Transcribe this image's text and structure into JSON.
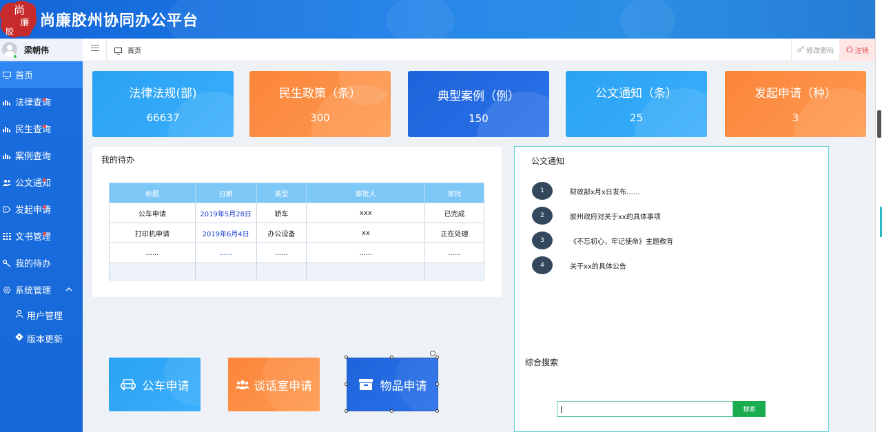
{
  "app": {
    "title": "尚廉胶州协同办公平台",
    "logo_text": "尚廉胶州"
  },
  "user": {
    "name": "梁朝伟"
  },
  "sidebar": {
    "items": [
      {
        "label": "首页",
        "icon": "monitor-icon"
      },
      {
        "label": "法律查询",
        "icon": "bar-chart-icon"
      },
      {
        "label": "民生查询",
        "icon": "bar-chart-icon"
      },
      {
        "label": "案例查询",
        "icon": "bar-chart-icon"
      },
      {
        "label": "公文通知",
        "icon": "users-icon"
      },
      {
        "label": "发起申请",
        "icon": "tag-icon"
      },
      {
        "label": "文书管理",
        "icon": "grid-icon"
      },
      {
        "label": "我的待办",
        "icon": "key-icon"
      },
      {
        "label": "系统管理",
        "icon": "gear-icon"
      }
    ],
    "sub_items": [
      {
        "label": "用户管理",
        "icon": "user-icon"
      },
      {
        "label": "版本更新",
        "icon": "git-icon"
      }
    ]
  },
  "breadcrumb": {
    "current": "首页"
  },
  "toolbar": {
    "change_password": "修改密码",
    "logout": "注销"
  },
  "stats": [
    {
      "label": "法律法规(部)",
      "value": "66637",
      "color": "blue"
    },
    {
      "label": "民生政策（条）",
      "value": "300",
      "color": "orange"
    },
    {
      "label": "典型案例（例）",
      "value": "150",
      "color": "dark-blue"
    },
    {
      "label": "公文通知（条）",
      "value": "25",
      "color": "blue"
    },
    {
      "label": "发起申请（种）",
      "value": "3",
      "color": "orange"
    }
  ],
  "todo": {
    "title": "我的待办",
    "columns": [
      "标题",
      "日期",
      "类型",
      "审批人",
      "审批"
    ],
    "rows": [
      [
        "公车申请",
        "2019年5月28日",
        "轿车",
        "xxx",
        "已完成"
      ],
      [
        "打印机申请",
        "2019年6月4日",
        "办公设备",
        "xx",
        "正在处理"
      ],
      [
        "......",
        "......",
        "......",
        "......",
        "......"
      ]
    ]
  },
  "notice": {
    "title": "公文通知",
    "items": [
      {
        "num": "1",
        "text": "财政部x月x日发布……"
      },
      {
        "num": "2",
        "text": "胶州政府对关于xx的具体事项"
      },
      {
        "num": "3",
        "text": "《不忘初心，牢记使命》主题教育"
      },
      {
        "num": "4",
        "text": "关于xx的具体公告"
      }
    ]
  },
  "search": {
    "title": "综合搜索",
    "value": "|",
    "button": "搜索"
  },
  "quick_actions": [
    {
      "label": "公车申请",
      "icon": "car-icon"
    },
    {
      "label": "谈话室申请",
      "icon": "group-icon"
    },
    {
      "label": "物品申请",
      "icon": "archive-icon"
    }
  ],
  "colors": {
    "brand": "#1a6ee0",
    "orange": "#fb853b",
    "light_blue": "#2aa2f3",
    "dark_blue": "#1e63da",
    "search_green": "#1aad4f"
  }
}
